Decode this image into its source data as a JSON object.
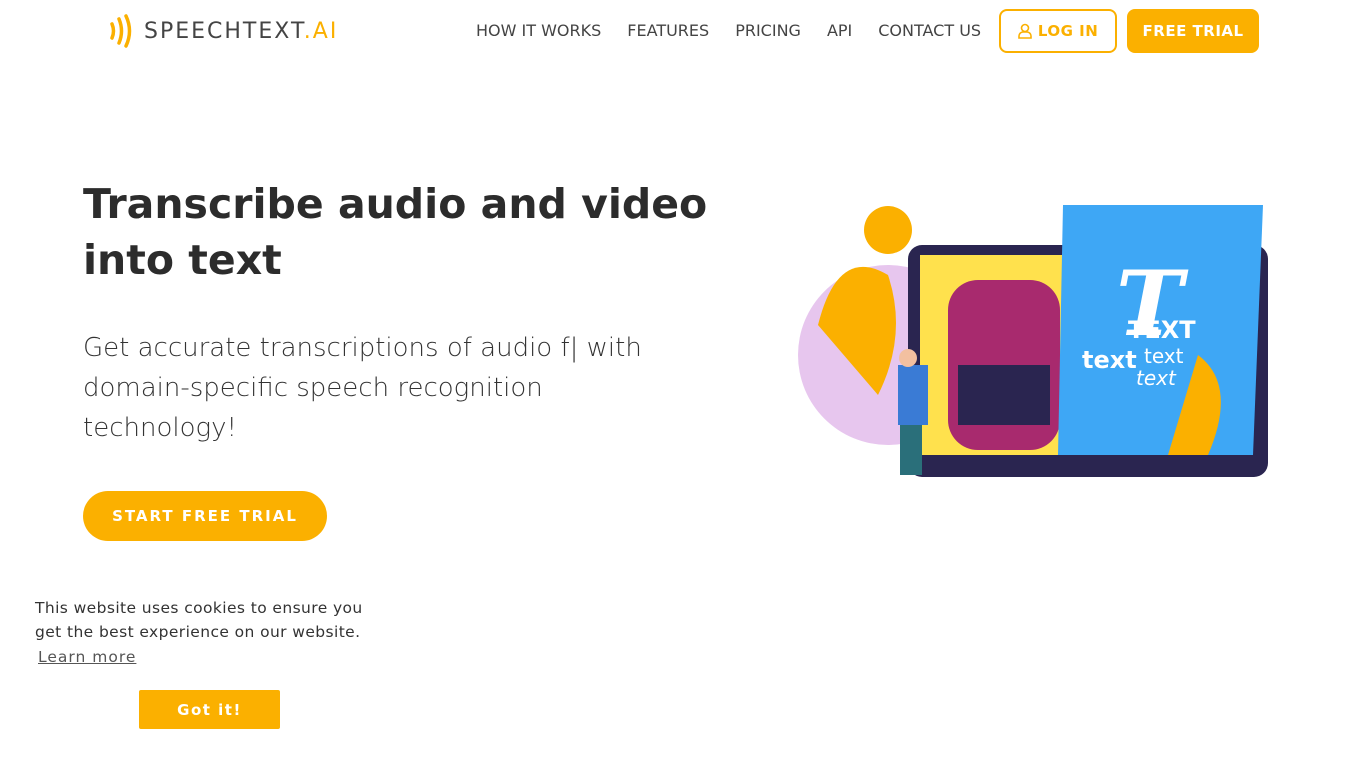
{
  "brand": {
    "name": "SPEECHTEXT",
    "suffix": ".AI",
    "accent": "#fbb000"
  },
  "nav": {
    "items": [
      "HOW IT WORKS",
      "FEATURES",
      "PRICING",
      "API",
      "CONTACT US"
    ],
    "login": "LOG IN",
    "free_trial": "FREE TRIAL"
  },
  "hero": {
    "title": "Transcribe audio and video into text",
    "subtitle": "Get accurate transcriptions of audio f| with domain-specific speech recognition technology!",
    "cta": "START FREE TRIAL"
  },
  "illustration": {
    "big_letter": "T",
    "word1": "TEXT",
    "word2": "text",
    "word3": "text",
    "word4": "text"
  },
  "cookie": {
    "message": "This website uses cookies to ensure you get the best experience on our website.",
    "learn_more": "Learn more",
    "accept": "Got it!"
  }
}
